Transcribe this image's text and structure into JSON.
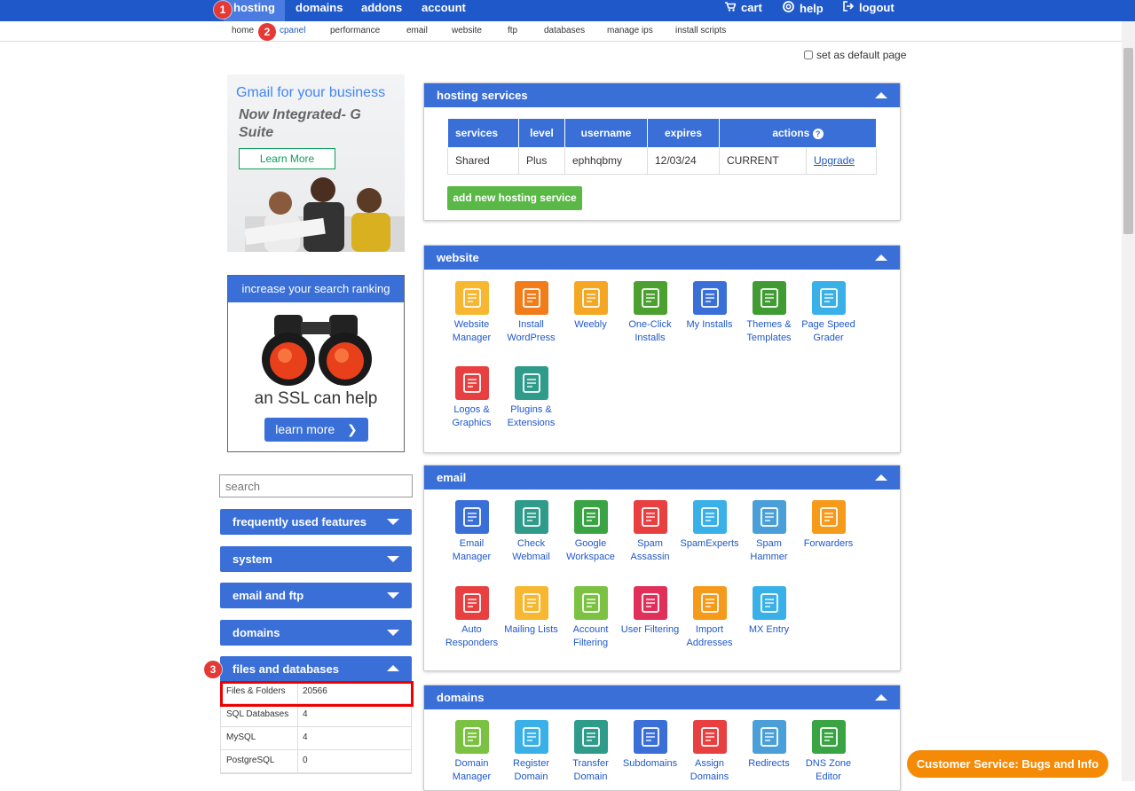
{
  "topnav": {
    "items": [
      {
        "label": "hosting"
      },
      {
        "label": "domains"
      },
      {
        "label": "addons"
      },
      {
        "label": "account"
      }
    ],
    "right": [
      {
        "label": "cart",
        "icon": "cart-icon"
      },
      {
        "label": "help",
        "icon": "lifebuoy-icon"
      },
      {
        "label": "logout",
        "icon": "logout-icon"
      }
    ]
  },
  "subnav": {
    "items": [
      {
        "label": "home"
      },
      {
        "label": "cpanel"
      },
      {
        "label": "performance"
      },
      {
        "label": "email"
      },
      {
        "label": "website"
      },
      {
        "label": "ftp"
      },
      {
        "label": "databases"
      },
      {
        "label": "manage ips"
      },
      {
        "label": "install scripts"
      }
    ]
  },
  "badges": [
    "1",
    "2",
    "3"
  ],
  "default_page_label": "set as default page",
  "ads": {
    "gsuite": {
      "title": "Gmail for your business",
      "subtitle": "Now Integrated- G Suite",
      "button": "Learn More"
    },
    "ssl": {
      "header": "increase your search ranking",
      "text": "an SSL can help",
      "button": "learn more"
    }
  },
  "sidebar": {
    "search_placeholder": "search",
    "sections": [
      {
        "label": "frequently used features"
      },
      {
        "label": "system"
      },
      {
        "label": "email and ftp"
      },
      {
        "label": "domains"
      },
      {
        "label": "files and databases"
      }
    ],
    "files_and_databases": [
      {
        "k": "Files & Folders",
        "v": "20566"
      },
      {
        "k": "SQL Databases",
        "v": "4"
      },
      {
        "k": "MySQL",
        "v": "4"
      },
      {
        "k": "PostgreSQL",
        "v": "0"
      }
    ]
  },
  "hosting_services": {
    "title": "hosting services",
    "headers": [
      "services",
      "level",
      "username",
      "expires",
      "actions"
    ],
    "row": {
      "service": "Shared",
      "level": "Plus",
      "username": "ephhqbmy",
      "expires": "12/03/24",
      "status": "CURRENT",
      "action": "Upgrade"
    },
    "add_button": "add new hosting service"
  },
  "website": {
    "title": "website",
    "items": [
      {
        "label": "Website Manager",
        "color": "#f7b731"
      },
      {
        "label": "Install WordPress",
        "color": "#f07d1a"
      },
      {
        "label": "Weebly",
        "color": "#f5a623"
      },
      {
        "label": "One-Click Installs",
        "color": "#4ca02f"
      },
      {
        "label": "My Installs",
        "color": "#3a6fd8"
      },
      {
        "label": "Themes & Templates",
        "color": "#3f9b32"
      },
      {
        "label": "Page Speed Grader",
        "color": "#3ab0e8"
      },
      {
        "label": "Logos & Graphics",
        "color": "#e84040"
      },
      {
        "label": "Plugins & Extensions",
        "color": "#2f9b8a"
      }
    ]
  },
  "email": {
    "title": "email",
    "items": [
      {
        "label": "Email Manager",
        "color": "#3a6fd8"
      },
      {
        "label": "Check Webmail",
        "color": "#2f9b8a"
      },
      {
        "label": "Google Workspace",
        "color": "#3aa445"
      },
      {
        "label": "Spam Assassin",
        "color": "#e84040"
      },
      {
        "label": "SpamExperts",
        "color": "#3ab0e8"
      },
      {
        "label": "Spam Hammer",
        "color": "#4a9fd8"
      },
      {
        "label": "Forwarders",
        "color": "#f59a1a"
      },
      {
        "label": "Auto Responders",
        "color": "#e84040"
      },
      {
        "label": "Mailing Lists",
        "color": "#f7b731"
      },
      {
        "label": "Account Filtering",
        "color": "#7cc242"
      },
      {
        "label": "User Filtering",
        "color": "#e0305a"
      },
      {
        "label": "Import Addresses",
        "color": "#f59a1a"
      },
      {
        "label": "MX Entry",
        "color": "#3ab0e8"
      }
    ]
  },
  "domains": {
    "title": "domains",
    "items": [
      {
        "label": "Domain Manager",
        "color": "#7cc242"
      },
      {
        "label": "Register Domain",
        "color": "#3ab0e8"
      },
      {
        "label": "Transfer Domain",
        "color": "#2f9b8a"
      },
      {
        "label": "Subdomains",
        "color": "#3a6fd8"
      },
      {
        "label": "Assign Domains",
        "color": "#e84040"
      },
      {
        "label": "Redirects",
        "color": "#4a9fd8"
      },
      {
        "label": "DNS Zone Editor",
        "color": "#3aa445"
      }
    ]
  },
  "customer_service": "Customer Service: Bugs and Info"
}
